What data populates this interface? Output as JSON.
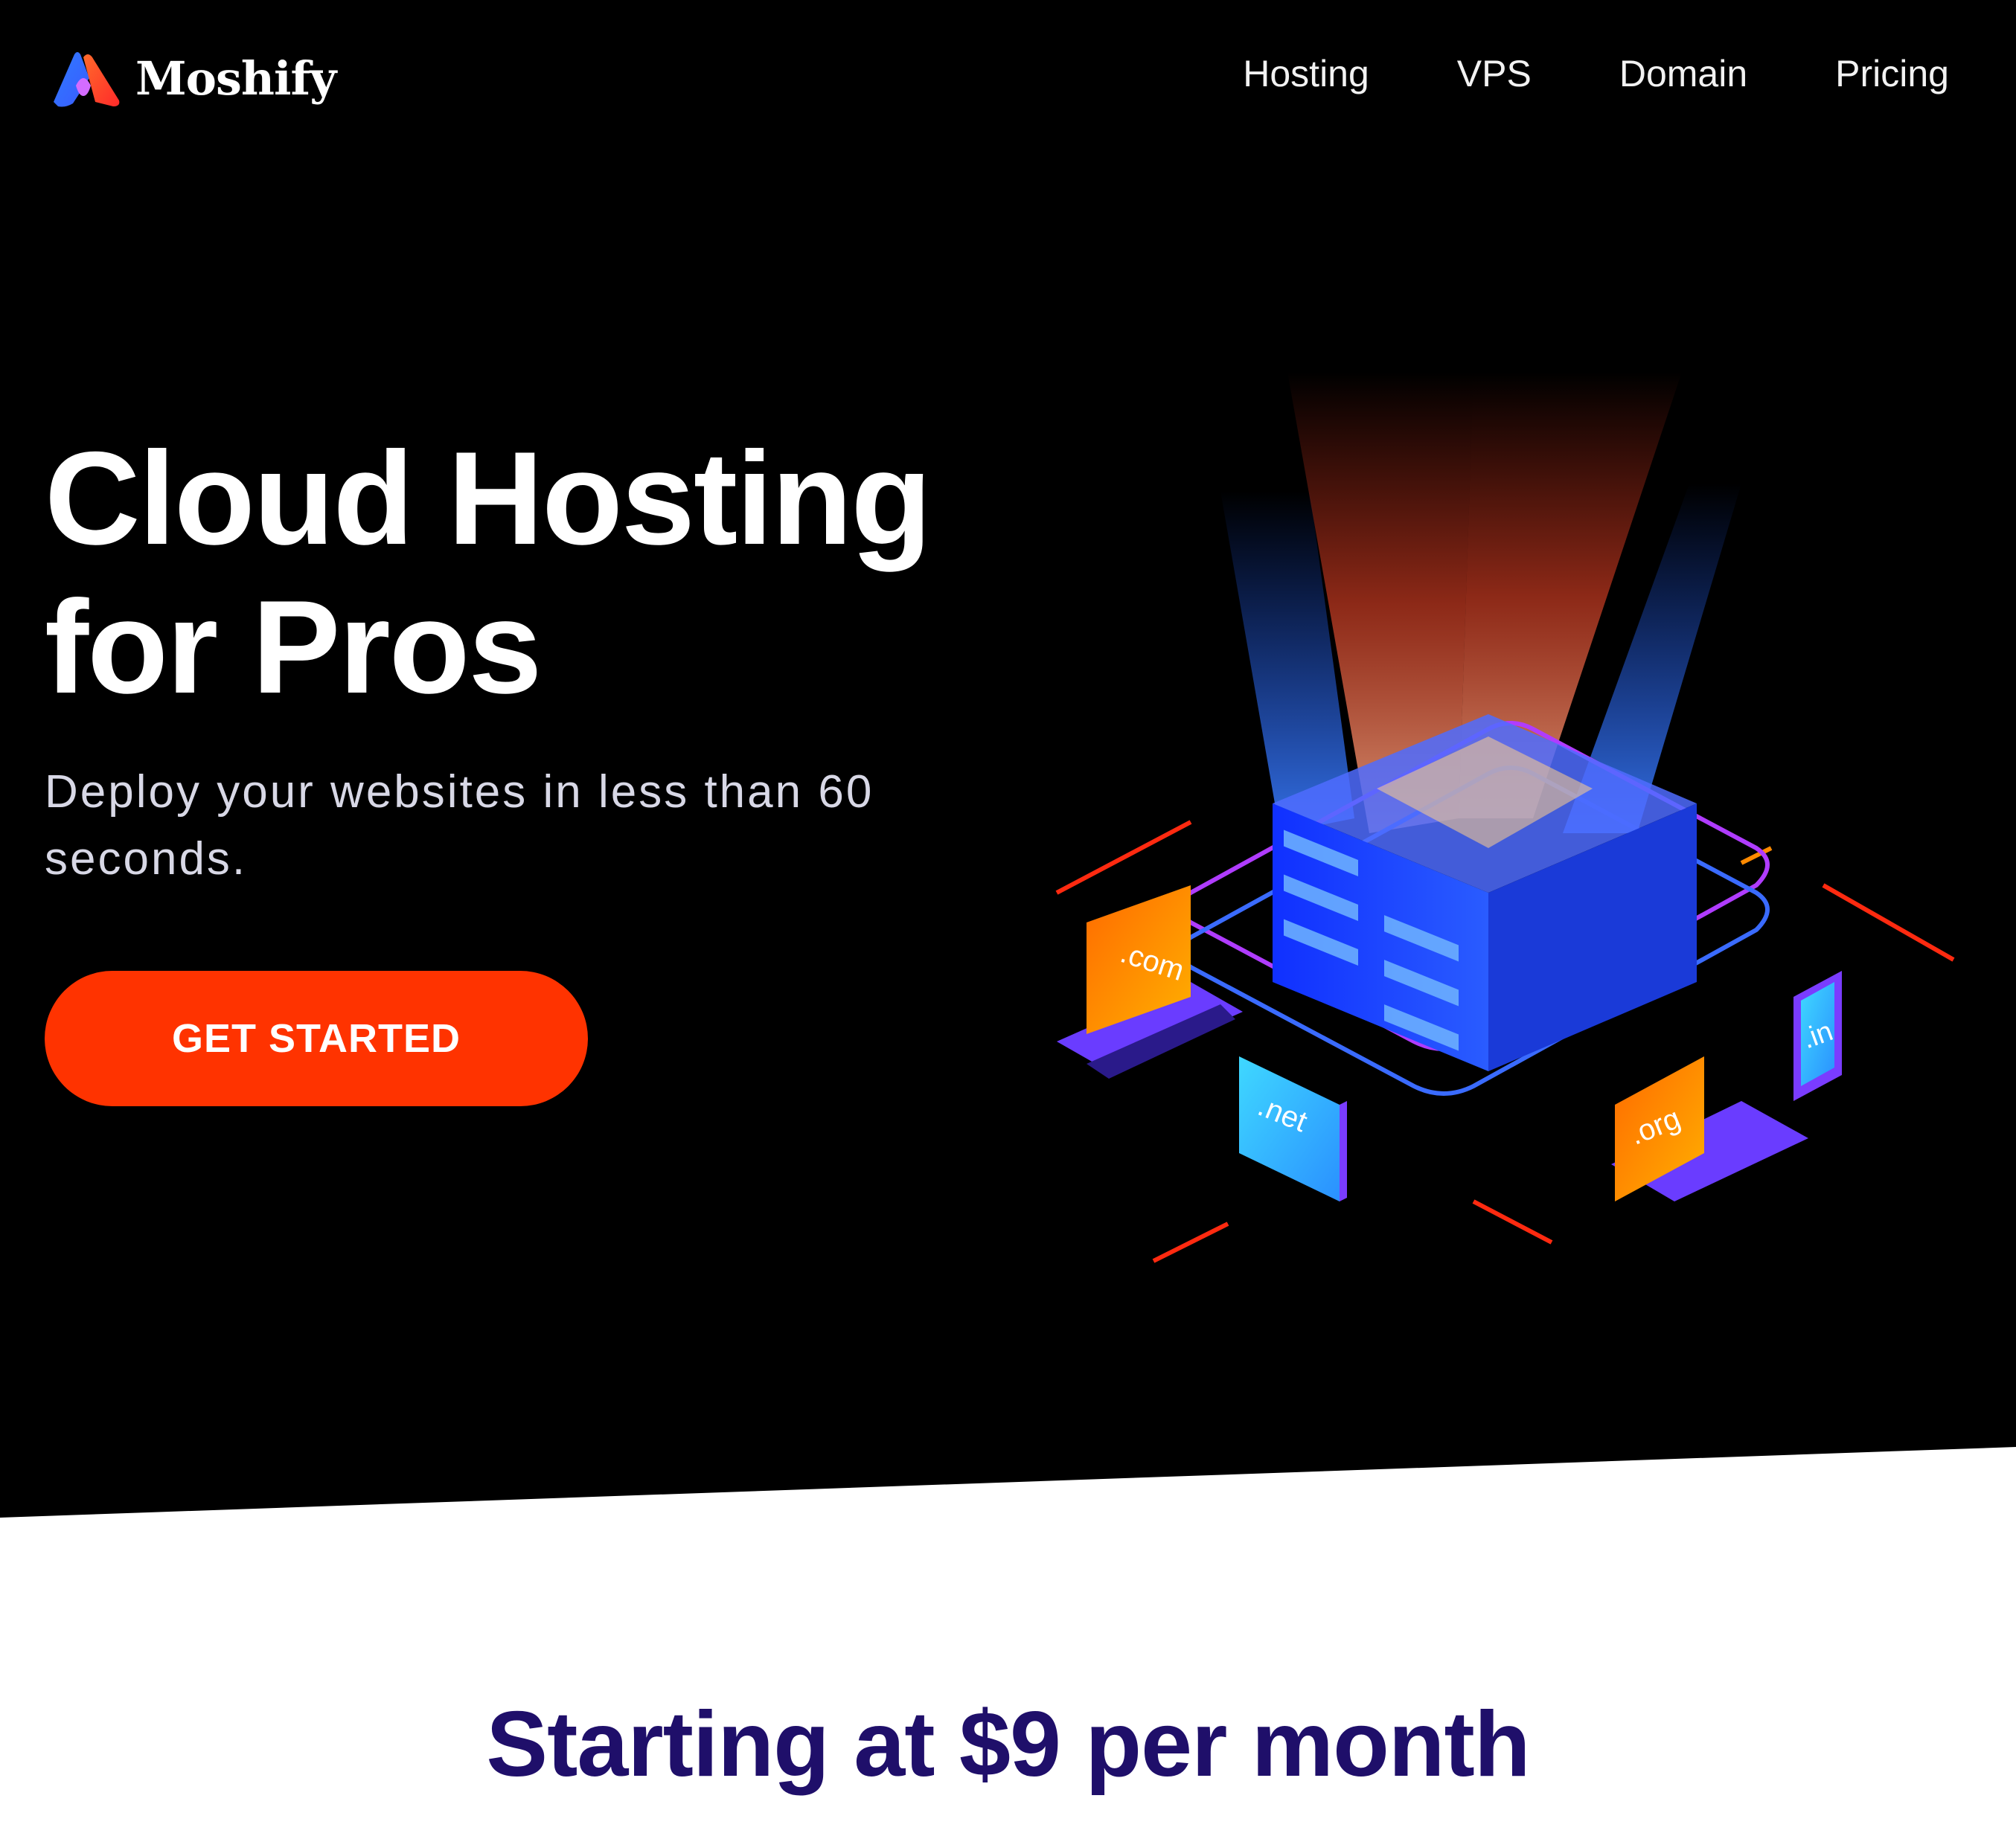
{
  "brand": {
    "name": "Moshify"
  },
  "nav": {
    "items": [
      {
        "label": "Hosting"
      },
      {
        "label": "VPS"
      },
      {
        "label": "Domain"
      },
      {
        "label": "Pricing"
      }
    ]
  },
  "hero": {
    "title_line1": "Cloud Hosting",
    "title_line2": "for Pros",
    "subtitle": "Deploy your websites in less than 60 seconds.",
    "cta_label": "GET STARTED"
  },
  "illustration": {
    "domains": [
      ".com",
      ".net",
      ".org",
      ".in"
    ]
  },
  "pricing": {
    "title": "Starting at $9 per month"
  },
  "colors": {
    "hero_bg": "#000000",
    "cta": "#ff3300",
    "pricing_title": "#1f0f6a",
    "server_blue": "#1a3cff",
    "accent_purple": "#7a3cff",
    "screen_orange": "#ff8a00"
  }
}
